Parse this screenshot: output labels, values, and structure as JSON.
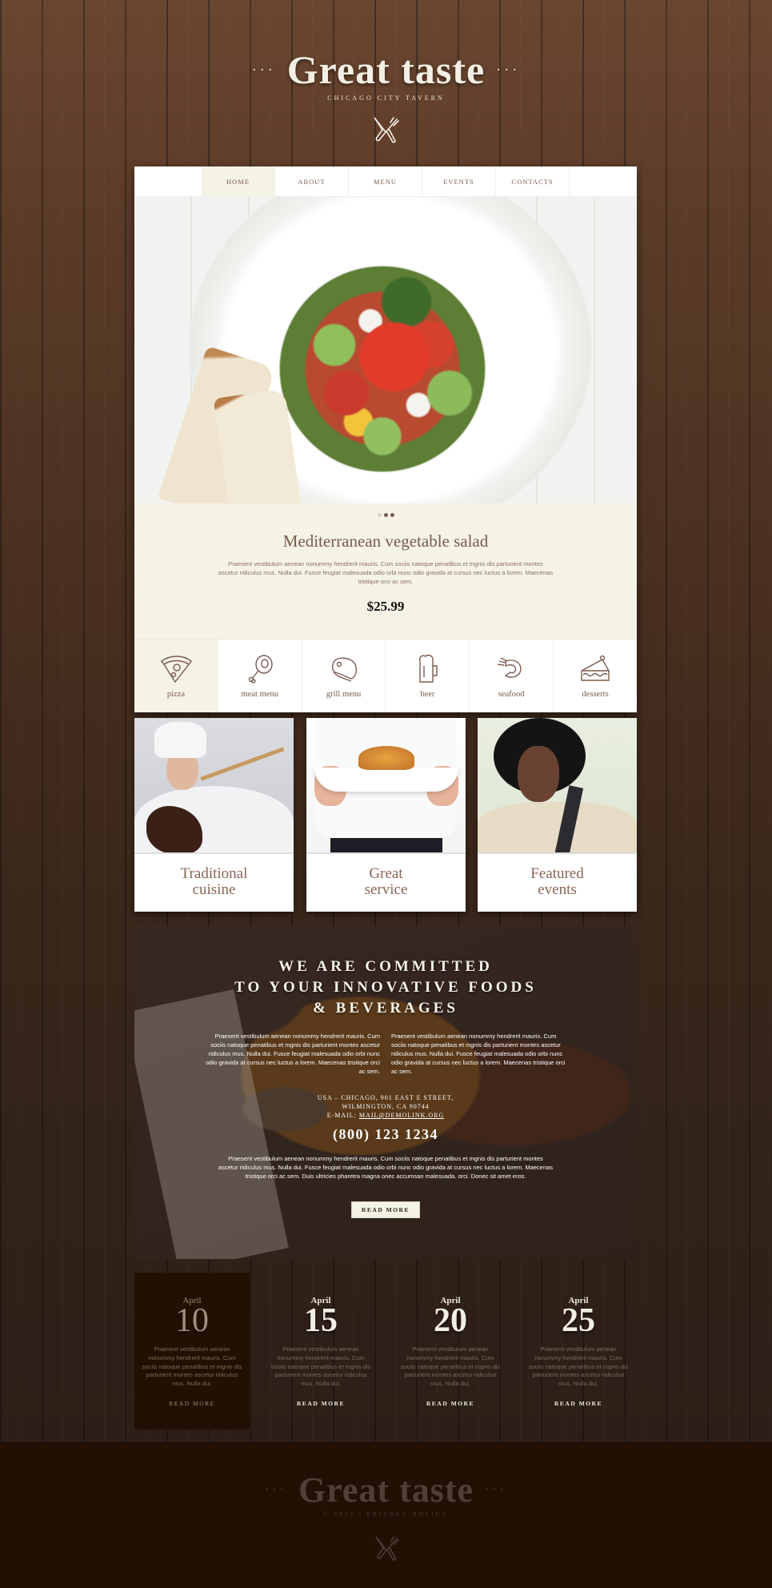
{
  "header": {
    "logo": "Great taste",
    "logo_dots": "···",
    "tagline": "CHICAGO CITY TAVERN",
    "logo_icon": "utensils-icon"
  },
  "nav": {
    "items": [
      {
        "label": "HOME",
        "active": true
      },
      {
        "label": "ABOUT",
        "active": false
      },
      {
        "label": "MENU",
        "active": false
      },
      {
        "label": "EVENTS",
        "active": false
      },
      {
        "label": "CONTACTS",
        "active": false
      }
    ]
  },
  "slider": {
    "dots": 3,
    "active_dot": 1,
    "title": "Mediterranean vegetable salad",
    "description": "Praesent vestibulum aenean nonummy hendrerit mauris. Cum sociis natoque penatibus et mgnis dis parturient montes ascetur ridiculus mus. Nulla dui. Fusce feugiat malesuada odio orbi nunc odio gravida at cursus nec luctus a lorem. Maecenas tristique orci ac sem.",
    "price": "$25.99"
  },
  "categories": [
    {
      "label": "pizza",
      "icon": "pizza-icon",
      "active": true
    },
    {
      "label": "meat menu",
      "icon": "meat-leg-icon",
      "active": false
    },
    {
      "label": "grill menu",
      "icon": "steak-icon",
      "active": false
    },
    {
      "label": "beer",
      "icon": "beer-mug-icon",
      "active": false
    },
    {
      "label": "seafood",
      "icon": "shrimp-icon",
      "active": false
    },
    {
      "label": "desserts",
      "icon": "cake-slice-icon",
      "active": false
    }
  ],
  "features": [
    {
      "line1": "Traditional",
      "line2": "cuisine"
    },
    {
      "line1": "Great",
      "line2": "service"
    },
    {
      "line1": "Featured",
      "line2": "events"
    }
  ],
  "committed": {
    "title_lines": [
      "WE ARE COMMITTED",
      "TO YOUR INNOVATIVE FOODS",
      "& BEVERAGES"
    ],
    "col_left": "Praesent vestibulum aenean nonummy hendrerit mauris. Cum sociis natoque penatibus et mgnis dis parturient montes ascetur ridiculus mus. Nulla dui. Fusce feugiat malesuada odio orbi nunc odio gravida at cursus nec luctus a lorem. Maecenas tristique orci ac sem.",
    "col_right": "Praesent vestibulum aenean nonummy hendrerit mauris. Cum sociis natoque penatibus et mgnis dis parturient montes ascetur ridiculus mus. Nulla dui. Fusce feugiat malesuada odio orbi nunc odio gravida at cursus nec luctus a lorem. Maecenas tristique orci ac sem.",
    "address_line1": "USA – CHICAGO, 901 EAST E STREET,",
    "address_line2": "WILMINGTON, CA 90744",
    "email_label": "E-MAIL:",
    "email": "MAIL@DEMOLINK.ORG",
    "phone": "(800) 123 1234",
    "paragraph": "Praesent vestibulum aenean nonummy hendrerit mauris. Cum sociis natoque penatibus et mgnis dis parturient montes ascetur ridiculus mus. Nulla dui. Fusce feugiat malesuada odio orbi nunc odio gravida at cursus nec luctus a lorem. Maecenas tristique orci ac sem. Duis ultricies pharetra magna onec accumsan malesuada. orci. Donec sit amet eros.",
    "button": "READ MORE"
  },
  "events": [
    {
      "month": "April",
      "day": "10",
      "text": "Praesent vestibulum aenean nonummy hendrerit mauris. Cum sociis natoque penatibus et mgnis dis parturient montes ascetur ridiculus mus. Nulla dui.",
      "link": "READ MORE",
      "active": true
    },
    {
      "month": "April",
      "day": "15",
      "text": "Praesent vestibulum aenean nonummy hendrerit mauris. Cum sociis natoque penatibus et mgnis dis parturient montes ascetur ridiculus mus. Nulla dui.",
      "link": "READ MORE",
      "active": false
    },
    {
      "month": "April",
      "day": "20",
      "text": "Praesent vestibulum aenean nonummy hendrerit mauris. Cum sociis natoque penatibus et mgnis dis parturient montes ascetur ridiculus mus. Nulla dui.",
      "link": "READ MORE",
      "active": false
    },
    {
      "month": "April",
      "day": "25",
      "text": "Praesent vestibulum aenean nonummy hendrerit mauris. Cum sociis natoque penatibus et mgnis dis parturient montes ascetur ridiculus mus. Nulla dui.",
      "link": "READ MORE",
      "active": false
    }
  ],
  "footer": {
    "logo": "Great taste",
    "logo_dots": "···",
    "copyright": "© 2015",
    "separator": "|",
    "privacy": "PRIVACY POLICY"
  },
  "colors": {
    "accent_brown": "#7a5c4e",
    "cream": "#f5f2e6",
    "dark_footer": "#231005"
  }
}
